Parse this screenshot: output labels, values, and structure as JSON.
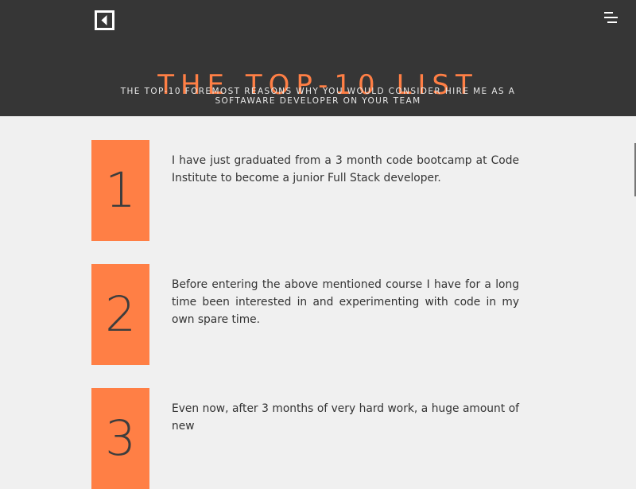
{
  "header": {
    "title": "THE TOP-10 LIST",
    "subtitle": "THE TOP-10 FOREMOST REASONS WHY YOU WOULD CONSIDER HIRE ME AS A SOFTAWARE DEVELOPER ON YOUR TEAM",
    "back_icon": "back-arrow-box-icon",
    "menu_icon": "hamburger-menu-icon"
  },
  "colors": {
    "header_background": "#363636",
    "accent": "#ff7f45",
    "page_background": "#f0f0f0",
    "text": "#333333"
  },
  "reasons": [
    {
      "number": "1",
      "text": "I have just graduated from a 3 month code bootcamp at Code Institute to become a junior Full Stack developer."
    },
    {
      "number": "2",
      "text": "Before entering the above mentioned course I have for a long time been interested in and experimenting with code in my own spare time."
    },
    {
      "number": "3",
      "text": "Even now, after 3 months of very hard work, a huge amount of new"
    }
  ]
}
